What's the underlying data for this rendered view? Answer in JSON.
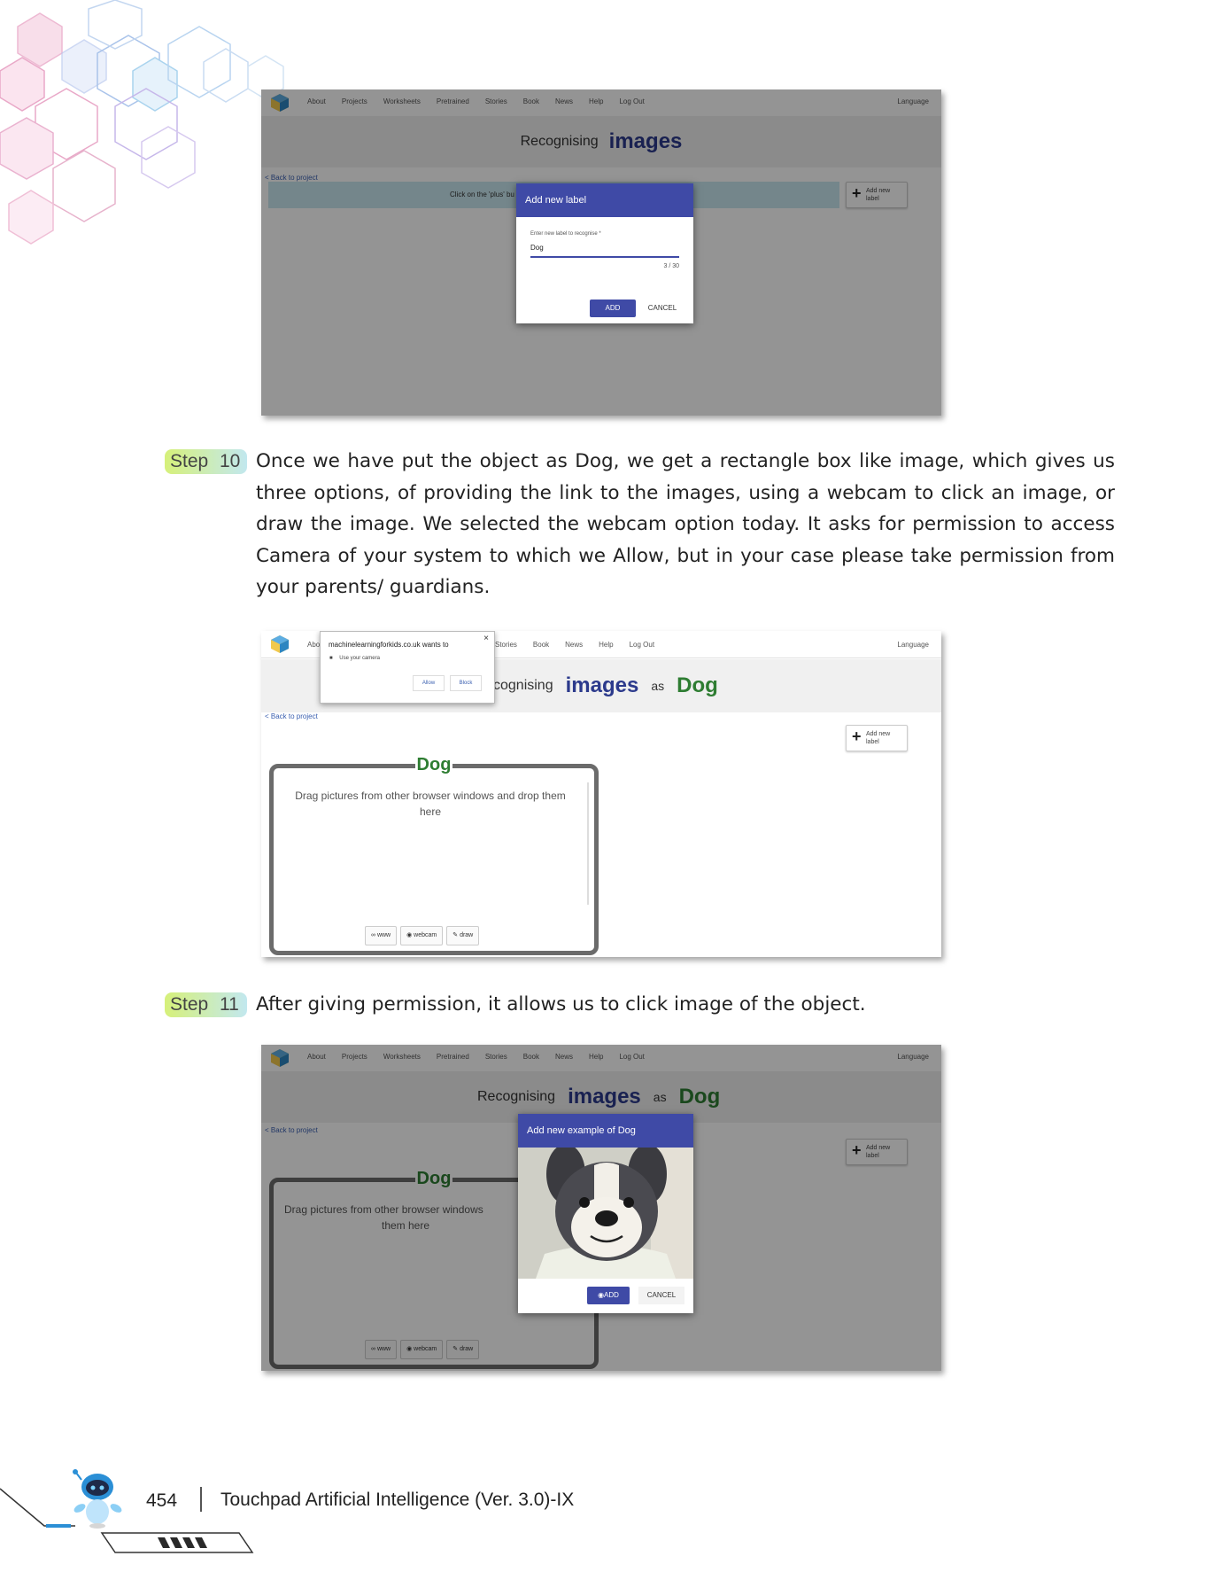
{
  "nav_links": [
    "About",
    "Projects",
    "Worksheets",
    "Pretrained",
    "Stories",
    "Book",
    "News",
    "Help",
    "Log Out"
  ],
  "nav_links_short": [
    "Stories",
    "Book",
    "News",
    "Help",
    "Log Out"
  ],
  "nav_language": "Language",
  "title_recognising": "Recognising",
  "title_recognising_cut": "cognising",
  "title_images": "images",
  "title_as": "as",
  "title_dog": "Dog",
  "back_link": "< Back to project",
  "add_new_label_btn": "Add new label",
  "shot1": {
    "banner_text": "Click on the 'plus' bu",
    "modal_title": "Add new label",
    "field_label": "Enter new label to recognise *",
    "field_value": "Dog",
    "char_count": "3 / 30",
    "add_btn": "ADD",
    "cancel_btn": "CANCEL"
  },
  "shot2": {
    "nav_about_cut": "Abo",
    "perm_site": "machinelearningforkids.co.uk wants to",
    "perm_close": "×",
    "perm_camera": "Use your camera",
    "perm_allow": "Allow",
    "perm_block": "Block"
  },
  "bucket": {
    "label": "Dog",
    "drag_text": "Drag pictures from other browser windows and drop them here",
    "drag_text_cut_1": "Drag pictures from other browser windows",
    "drag_text_cut_2": "them here",
    "tool_www": "www",
    "tool_webcam": "webcam",
    "tool_draw": "draw"
  },
  "shot3": {
    "modal_title": "Add new example of Dog",
    "add_btn": "ADD",
    "cancel_btn": "CANCEL"
  },
  "step10": {
    "word": "Step",
    "num": "10",
    "text": "Once we have put the object as Dog, we get a rectangle box like image, which gives us three options, of providing the link to the images, using a webcam to click an image, or draw the image. We selected the webcam option today. It asks for permission to access Camera of your system to which we Allow, but in your case please take permission from your parents/ guardians."
  },
  "step11": {
    "word": "Step",
    "num": "11",
    "text": "After giving permission, it allows us to click image of the object."
  },
  "footer": {
    "page_number": "454",
    "book_title": "Touchpad Artificial Intelligence (Ver. 3.0)-IX"
  },
  "colors": {
    "modal_header": "#3f4aa6",
    "title_images": "#2c3a8c",
    "title_dog": "#2e7d32",
    "step_gradient_start": "#d6f07a",
    "step_gradient_end": "#c2e8ef"
  }
}
